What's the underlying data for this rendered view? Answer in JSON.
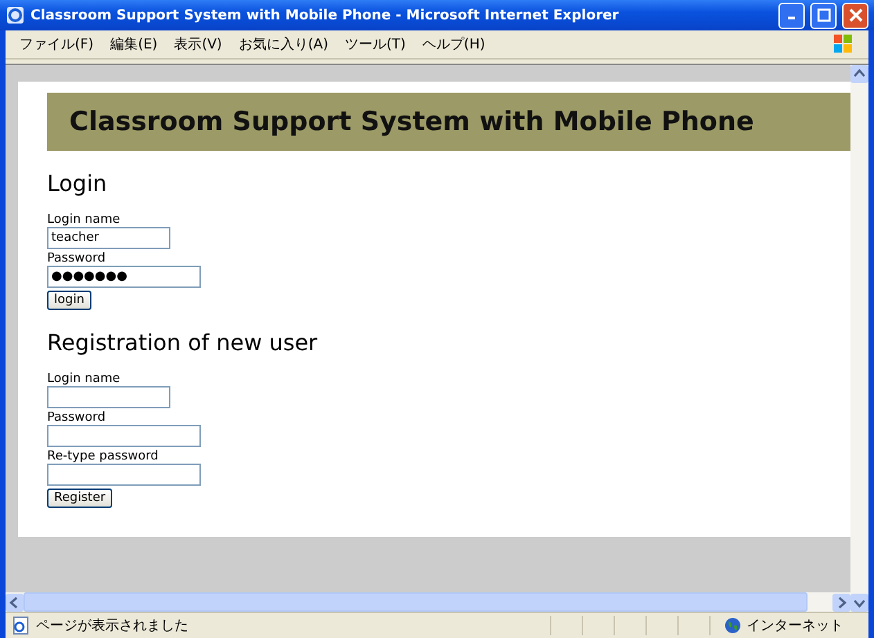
{
  "window": {
    "title": "Classroom Support System with Mobile Phone - Microsoft Internet Explorer"
  },
  "menu": [
    "ファイル(F)",
    "編集(E)",
    "表示(V)",
    "お気に入り(A)",
    "ツール(T)",
    "ヘルプ(H)"
  ],
  "page": {
    "banner": "Classroom Support System with Mobile Phone",
    "sections": [
      {
        "heading": "Login",
        "fields": [
          {
            "label": "Login name",
            "value": "teacher",
            "kind": "short"
          },
          {
            "label": "Password",
            "value": "●●●●●●●",
            "kind": "long"
          }
        ],
        "button": "login"
      },
      {
        "heading": "Registration of new user",
        "fields": [
          {
            "label": "Login name",
            "kind": "short"
          },
          {
            "label": "Password",
            "kind": "long"
          },
          {
            "label": "Re-type password",
            "kind": "long"
          }
        ],
        "button": "Register"
      }
    ]
  },
  "status_bar": {
    "message": "ページが表示されました",
    "zone": "インターネット"
  }
}
